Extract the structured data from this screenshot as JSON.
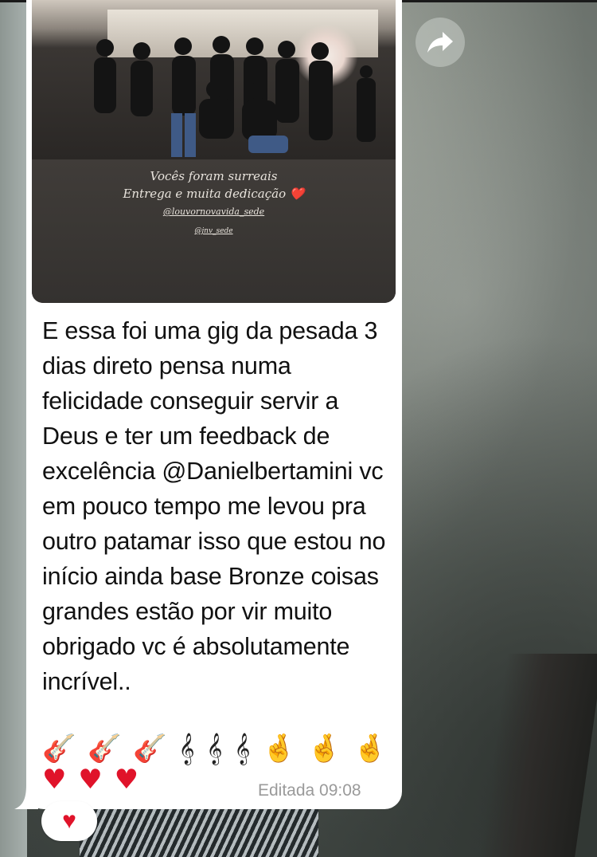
{
  "photo": {
    "caption_line1": "Vocês foram surreais",
    "caption_line2": "Entrega e muita dedicação ❤️",
    "tag1": "@louvornovavida_sede",
    "tag2": "@jnv_sede"
  },
  "message": {
    "text": "E essa foi uma gig da pesada 3 dias direto pensa numa felicidade conseguir servir a Deus e ter um feedback de excelência @Danielbertamini vc em pouco tempo me levou pra outro patamar isso que estou no início ainda base Bronze coisas grandes estão por vir muito obrigado vc é absolutamente incrível..",
    "emoji_row1": [
      "🎸",
      "🎸",
      "🎸",
      "𝄞",
      "𝄞",
      "𝄞",
      "🤞",
      "🤞",
      "🤞"
    ],
    "emoji_row2": [
      "♥",
      "♥",
      "♥"
    ],
    "status": "Editada 09:08"
  },
  "reaction": {
    "emoji": "♥"
  },
  "icons": {
    "forward": "forward-arrow-icon"
  },
  "colors": {
    "bubble": "#ffffff",
    "text": "#111111",
    "meta": "#9a9a9a",
    "heart": "#e0132a"
  }
}
